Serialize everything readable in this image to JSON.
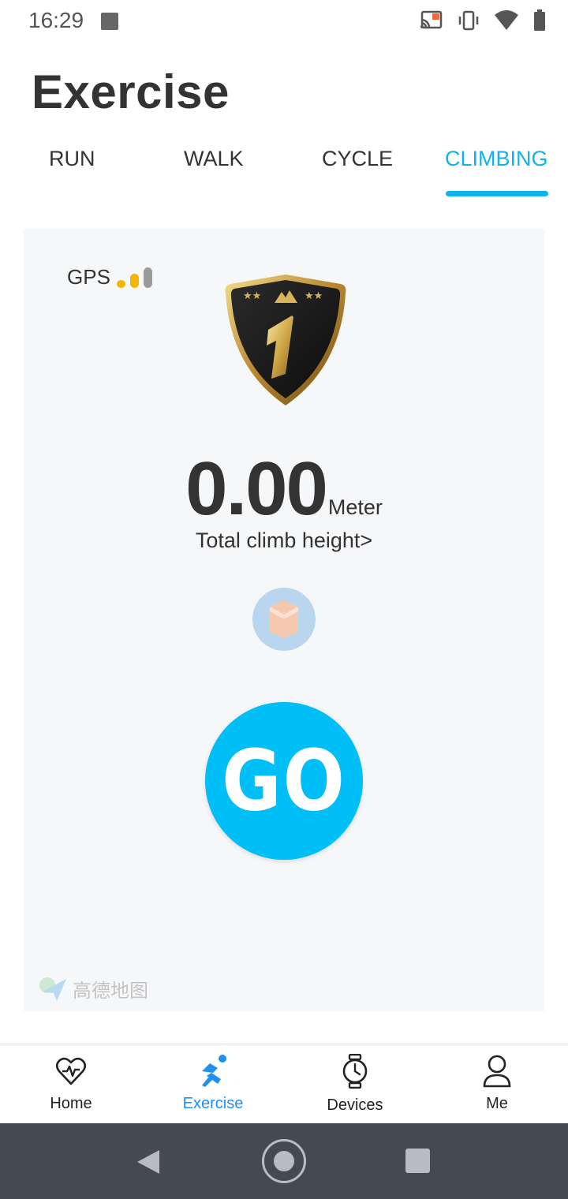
{
  "status_bar": {
    "time": "16:29",
    "icons": [
      "app-notification-icon",
      "cast-icon",
      "vibrate-icon",
      "wifi-icon",
      "battery-icon"
    ]
  },
  "header": {
    "title": "Exercise"
  },
  "tabs": [
    {
      "label": "RUN",
      "active": false
    },
    {
      "label": "WALK",
      "active": false
    },
    {
      "label": "CYCLE",
      "active": false
    },
    {
      "label": "CLIMBING",
      "active": true
    }
  ],
  "card": {
    "gps_label": "GPS",
    "gps_signal_colors": [
      "#f2b705",
      "#f2b705",
      "#9a9a9a"
    ],
    "badge_rank": "1",
    "metric_value": "0.00",
    "metric_unit": "Meter",
    "metric_label": "Total climb height>",
    "go_label": "GO",
    "map_provider_label": "高德地图"
  },
  "bottom_nav": [
    {
      "label": "Home",
      "icon": "heart-pulse-icon",
      "active": false
    },
    {
      "label": "Exercise",
      "icon": "runner-icon",
      "active": true
    },
    {
      "label": "Devices",
      "icon": "watch-icon",
      "active": false
    },
    {
      "label": "Me",
      "icon": "person-icon",
      "active": false
    }
  ],
  "colors": {
    "accent": "#11b3ee",
    "go_button": "#00bff6",
    "nav_active": "#1f8ff0",
    "system_nav_bg": "#454a50"
  }
}
